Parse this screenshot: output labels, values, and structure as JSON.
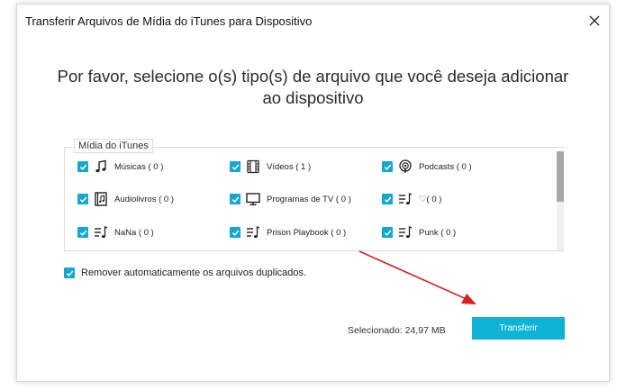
{
  "window": {
    "title": "Transferir Arquivos de Mídia do iTunes para Dispositivo"
  },
  "heading": "Por favor, selecione o(s) tipo(s) de arquivo que você deseja adicionar ao dispositivo",
  "group": {
    "legend": "Mídia do iTunes",
    "items": [
      {
        "label": "Músicas ( 0 )",
        "icon": "music-note-icon",
        "checked": true
      },
      {
        "label": "Vídeos ( 1 )",
        "icon": "film-icon",
        "checked": true
      },
      {
        "label": "Podcasts ( 0 )",
        "icon": "podcast-icon",
        "checked": true
      },
      {
        "label": "Audiolivros ( 0 )",
        "icon": "audiobook-icon",
        "checked": true
      },
      {
        "label": "Programas de TV ( 0 )",
        "icon": "tv-icon",
        "checked": true
      },
      {
        "label": "♡( 0 )",
        "icon": "playlist-icon",
        "checked": true
      },
      {
        "label": "NaNa ( 0 )",
        "icon": "playlist-icon",
        "checked": true
      },
      {
        "label": "Prison Playbook ( 0 )",
        "icon": "playlist-icon",
        "checked": true
      },
      {
        "label": "Punk ( 0 )",
        "icon": "playlist-icon",
        "checked": true
      }
    ]
  },
  "dedupe": {
    "label": "Remover automaticamente os arquivos duplicados.",
    "checked": true
  },
  "footer": {
    "selected": "Selecionado: 24,97 MB",
    "transfer_label": "Transferir"
  },
  "colors": {
    "accent": "#0eb4d6",
    "checkbox": "#14a8d0",
    "annotation_arrow": "#d9201f"
  }
}
